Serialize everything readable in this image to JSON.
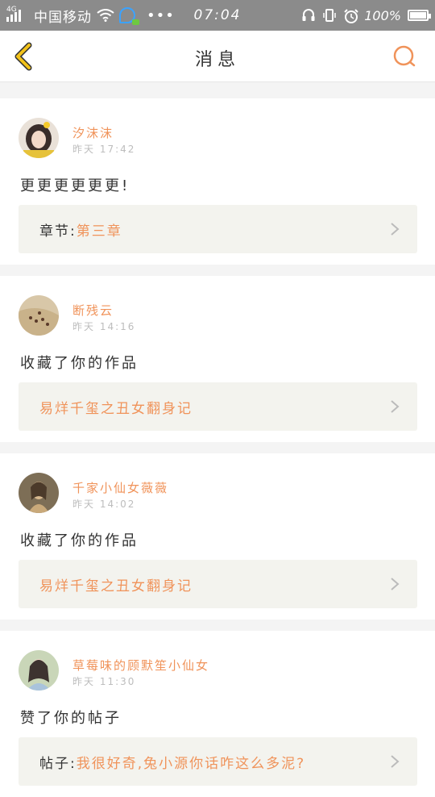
{
  "status_bar": {
    "network_type": "4G",
    "carrier": "中国移动",
    "more": "•••",
    "time": "07:04",
    "battery_percent": "100%",
    "battery_level": 1.0
  },
  "header": {
    "title": "消息",
    "back_icon": "chevron-left-icon",
    "search_icon": "search-icon",
    "accent_color": "#f0935a",
    "back_color": "#f2c21a"
  },
  "messages": [
    {
      "username": "汐沫沫",
      "time": "昨天 17:42",
      "content": "更更更更更更!",
      "ref_prefix": "章节:",
      "ref_link": "第三章"
    },
    {
      "username": "断残云",
      "time": "昨天 14:16",
      "content": "收藏了你的作品",
      "ref_prefix": "",
      "ref_link": "易烊千玺之丑女翻身记"
    },
    {
      "username": "千家小仙女薇薇",
      "time": "昨天 14:02",
      "content": "收藏了你的作品",
      "ref_prefix": "",
      "ref_link": "易烊千玺之丑女翻身记"
    },
    {
      "username": "草莓味的顾默笙小仙女",
      "time": "昨天 11:30",
      "content": "赞了你的帖子",
      "ref_prefix": "帖子:",
      "ref_link": "我很好奇,兔小源你话咋这么多泥?"
    }
  ]
}
